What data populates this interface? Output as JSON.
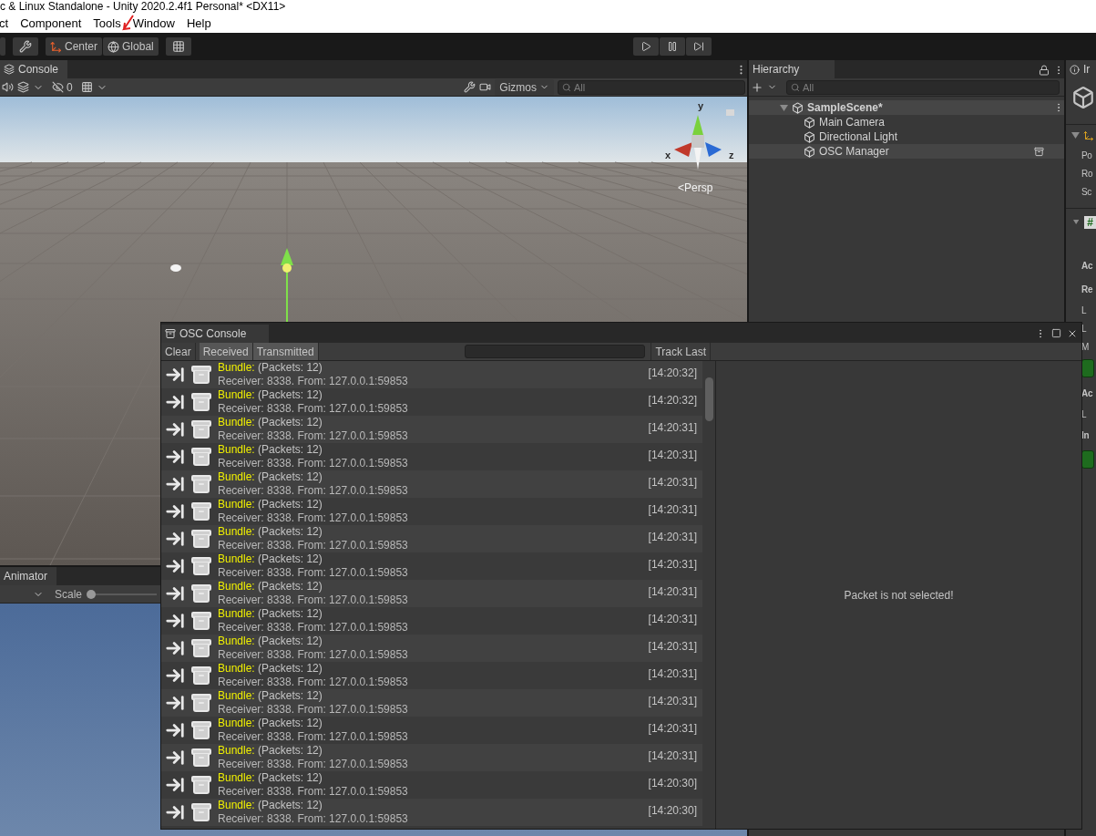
{
  "window": {
    "title": "c & Linux Standalone - Unity 2020.2.4f1 Personal* <DX11>"
  },
  "menu": [
    "ct",
    "Component",
    "Tools",
    "Window",
    "Help"
  ],
  "toolbar": {
    "pivot": "Center",
    "space": "Global"
  },
  "scene": {
    "tab": "Console",
    "hidden_count": "0",
    "gizmos": "Gizmos",
    "search_placeholder": "All",
    "axes": {
      "y": "y",
      "x": "x",
      "z": "z"
    },
    "projection": "<Persp"
  },
  "hierarchy": {
    "tab": "Hierarchy",
    "search_placeholder": "All",
    "scene": {
      "label": "SampleScene*",
      "expanded": true,
      "children": [
        {
          "label": "Main Camera",
          "selected": false
        },
        {
          "label": "Directional Light",
          "selected": false
        },
        {
          "label": "OSC Manager",
          "selected": true
        }
      ]
    }
  },
  "inspector": {
    "tab": "Ir",
    "rows": [
      {
        "kind": "label",
        "text": "Po"
      },
      {
        "kind": "label",
        "text": "Ro"
      },
      {
        "kind": "label",
        "text": "Sc"
      },
      {
        "kind": "header",
        "text": "#"
      },
      {
        "kind": "section",
        "text": "Ac"
      },
      {
        "kind": "section",
        "text": "Re"
      },
      {
        "kind": "label",
        "text": "L"
      },
      {
        "kind": "label",
        "text": "L"
      },
      {
        "kind": "label",
        "text": "M"
      },
      {
        "kind": "toggle"
      },
      {
        "kind": "section",
        "text": "Ac"
      },
      {
        "kind": "label",
        "text": "L"
      },
      {
        "kind": "section",
        "text": "In"
      },
      {
        "kind": "toggle"
      }
    ]
  },
  "animator": {
    "tab": "Animator",
    "scale_label": "Scale",
    "scale_slider": {
      "level": 0
    }
  },
  "osc_console": {
    "title": "OSC Console",
    "clear": "Clear",
    "filters": [
      {
        "label": "Received",
        "on": true
      },
      {
        "label": "Transmitted",
        "on": true
      }
    ],
    "track_last": "Track Last",
    "messages": [
      {
        "type": "Bundle:",
        "detail": "(Packets: 12)",
        "source": "Receiver: 8338. From: 127.0.0.1:59853",
        "time": "[14:20:32]"
      },
      {
        "type": "Bundle:",
        "detail": "(Packets: 12)",
        "source": "Receiver: 8338. From: 127.0.0.1:59853",
        "time": "[14:20:32]"
      },
      {
        "type": "Bundle:",
        "detail": "(Packets: 12)",
        "source": "Receiver: 8338. From: 127.0.0.1:59853",
        "time": "[14:20:31]"
      },
      {
        "type": "Bundle:",
        "detail": "(Packets: 12)",
        "source": "Receiver: 8338. From: 127.0.0.1:59853",
        "time": "[14:20:31]"
      },
      {
        "type": "Bundle:",
        "detail": "(Packets: 12)",
        "source": "Receiver: 8338. From: 127.0.0.1:59853",
        "time": "[14:20:31]"
      },
      {
        "type": "Bundle:",
        "detail": "(Packets: 12)",
        "source": "Receiver: 8338. From: 127.0.0.1:59853",
        "time": "[14:20:31]"
      },
      {
        "type": "Bundle:",
        "detail": "(Packets: 12)",
        "source": "Receiver: 8338. From: 127.0.0.1:59853",
        "time": "[14:20:31]"
      },
      {
        "type": "Bundle:",
        "detail": "(Packets: 12)",
        "source": "Receiver: 8338. From: 127.0.0.1:59853",
        "time": "[14:20:31]"
      },
      {
        "type": "Bundle:",
        "detail": "(Packets: 12)",
        "source": "Receiver: 8338. From: 127.0.0.1:59853",
        "time": "[14:20:31]"
      },
      {
        "type": "Bundle:",
        "detail": "(Packets: 12)",
        "source": "Receiver: 8338. From: 127.0.0.1:59853",
        "time": "[14:20:31]"
      },
      {
        "type": "Bundle:",
        "detail": "(Packets: 12)",
        "source": "Receiver: 8338. From: 127.0.0.1:59853",
        "time": "[14:20:31]"
      },
      {
        "type": "Bundle:",
        "detail": "(Packets: 12)",
        "source": "Receiver: 8338. From: 127.0.0.1:59853",
        "time": "[14:20:31]"
      },
      {
        "type": "Bundle:",
        "detail": "(Packets: 12)",
        "source": "Receiver: 8338. From: 127.0.0.1:59853",
        "time": "[14:20:31]"
      },
      {
        "type": "Bundle:",
        "detail": "(Packets: 12)",
        "source": "Receiver: 8338. From: 127.0.0.1:59853",
        "time": "[14:20:31]"
      },
      {
        "type": "Bundle:",
        "detail": "(Packets: 12)",
        "source": "Receiver: 8338. From: 127.0.0.1:59853",
        "time": "[14:20:31]"
      },
      {
        "type": "Bundle:",
        "detail": "(Packets: 12)",
        "source": "Receiver: 8338. From: 127.0.0.1:59853",
        "time": "[14:20:30]"
      },
      {
        "type": "Bundle:",
        "detail": "(Packets: 12)",
        "source": "Receiver: 8338. From: 127.0.0.1:59853",
        "time": "[14:20:30]"
      }
    ],
    "empty_detail": "Packet is not selected!"
  }
}
